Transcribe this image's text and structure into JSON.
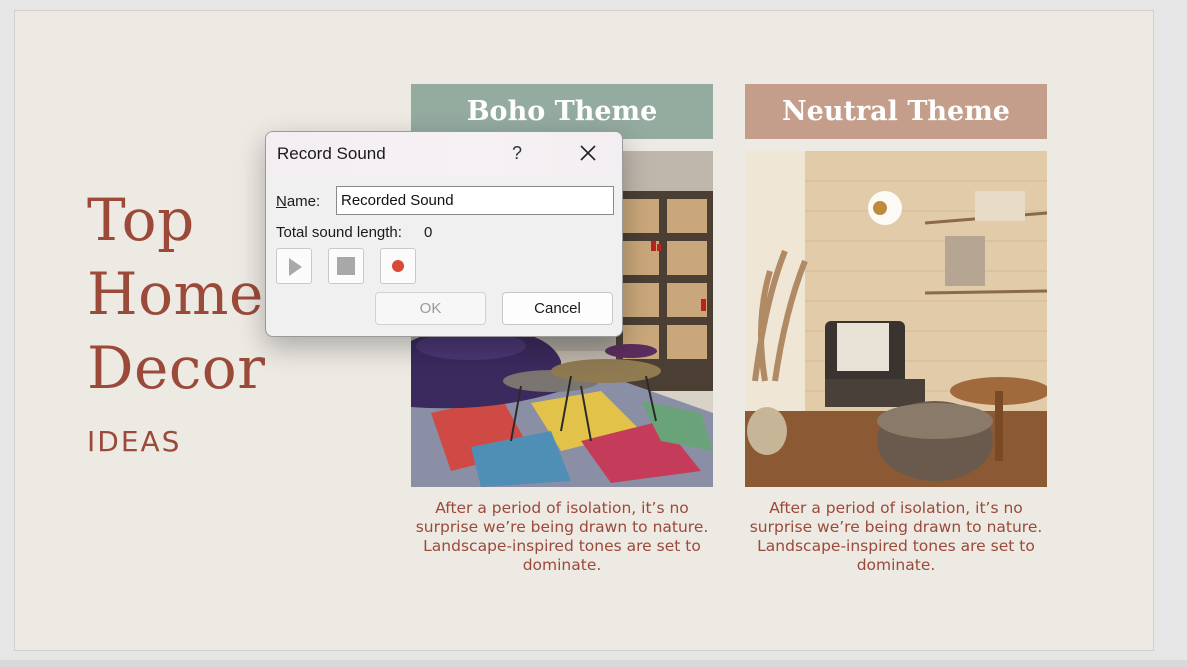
{
  "slide": {
    "title_lines": [
      "Top",
      "Home",
      "Decor"
    ],
    "subtitle": "IDEAS",
    "themes": [
      {
        "title": "Boho Theme",
        "caption": "After a period of isolation, it’s no surprise we’re being drawn to nature. Landscape-inspired tones are set to dominate."
      },
      {
        "title": "Neutral Theme",
        "caption": "After a period of isolation, it’s no surprise we’re being drawn to nature. Landscape-inspired tones are set to dominate."
      }
    ]
  },
  "dialog": {
    "title": "Record Sound",
    "help_label": "?",
    "name_label_prefix": "N",
    "name_label_rest": "ame:",
    "name_value": "Recorded Sound",
    "length_label": "Total sound length:",
    "length_value": "0",
    "ok_label": "OK",
    "cancel_label": "Cancel",
    "icons": [
      "play-icon",
      "stop-icon",
      "record-icon",
      "close-icon"
    ],
    "colors": {
      "record": "#d94a38"
    }
  }
}
